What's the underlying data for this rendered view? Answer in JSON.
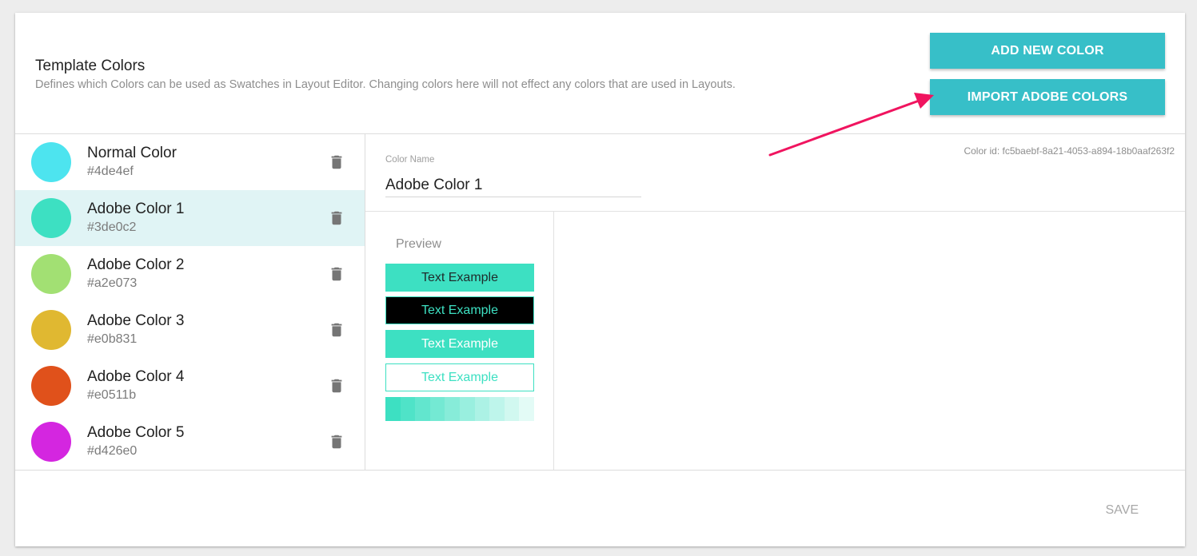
{
  "header": {
    "title": "Template Colors",
    "subtitle": "Defines which Colors can be used as Swatches in Layout Editor. Changing colors here will not effect any colors that are used in Layouts.",
    "add_button": "ADD NEW COLOR",
    "import_button": "IMPORT ADOBE COLORS"
  },
  "colors": [
    {
      "name": "Normal Color",
      "hex": "#4de4ef"
    },
    {
      "name": "Adobe Color 1",
      "hex": "#3de0c2"
    },
    {
      "name": "Adobe Color 2",
      "hex": "#a2e073"
    },
    {
      "name": "Adobe Color 3",
      "hex": "#e0b831"
    },
    {
      "name": "Adobe Color 4",
      "hex": "#e0511b"
    },
    {
      "name": "Adobe Color 5",
      "hex": "#d426e0"
    }
  ],
  "selected_index": 1,
  "detail": {
    "color_id": "Color id: fc5baebf-8a21-4053-a894-18b0aaf263f2",
    "field_label": "Color Name",
    "field_value": "Adobe Color 1",
    "preview_label": "Preview",
    "example_text": "Text Example"
  },
  "footer": {
    "save_label": "SAVE"
  },
  "theme": {
    "accent": "#37bfc8",
    "selected_bg": "#e0f4f5",
    "annotation_arrow": "#f0145f",
    "icons": [
      "trash-icon"
    ]
  }
}
